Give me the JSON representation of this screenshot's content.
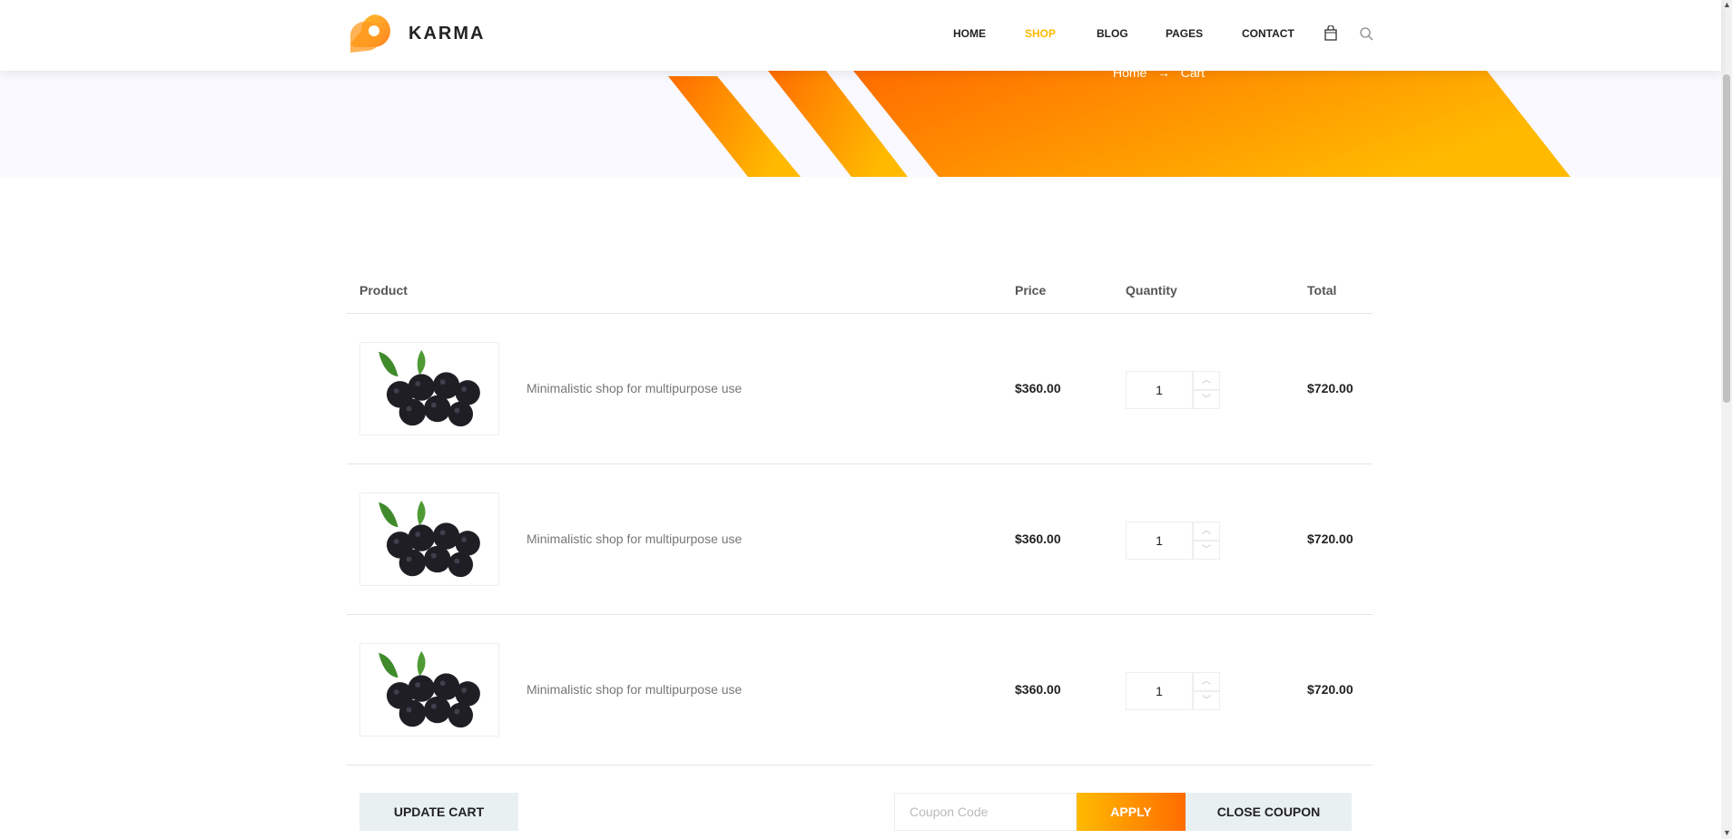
{
  "header": {
    "brand": "KARMA",
    "nav": [
      "HOME",
      "SHOP",
      "BLOG",
      "PAGES",
      "CONTACT"
    ],
    "active_nav": "SHOP",
    "icons": [
      "shopping-bag-icon",
      "search-icon"
    ]
  },
  "breadcrumb": {
    "items": [
      "Home",
      "Cart"
    ]
  },
  "table": {
    "headers": {
      "product": "Product",
      "price": "Price",
      "quantity": "Quantity",
      "total": "Total"
    },
    "rows": [
      {
        "name": "Minimalistic shop for multipurpose use",
        "price": "$360.00",
        "quantity": "1",
        "total": "$720.00"
      },
      {
        "name": "Minimalistic shop for multipurpose use",
        "price": "$360.00",
        "quantity": "1",
        "total": "$720.00"
      },
      {
        "name": "Minimalistic shop for multipurpose use",
        "price": "$360.00",
        "quantity": "1",
        "total": "$720.00"
      }
    ]
  },
  "actions": {
    "update_cart": "UPDATE CART",
    "coupon_placeholder": "Coupon Code",
    "apply": "APPLY",
    "close_coupon": "CLOSE COUPON"
  },
  "colors": {
    "accent": "#ffba00",
    "accent_dark": "#ff6c00"
  }
}
